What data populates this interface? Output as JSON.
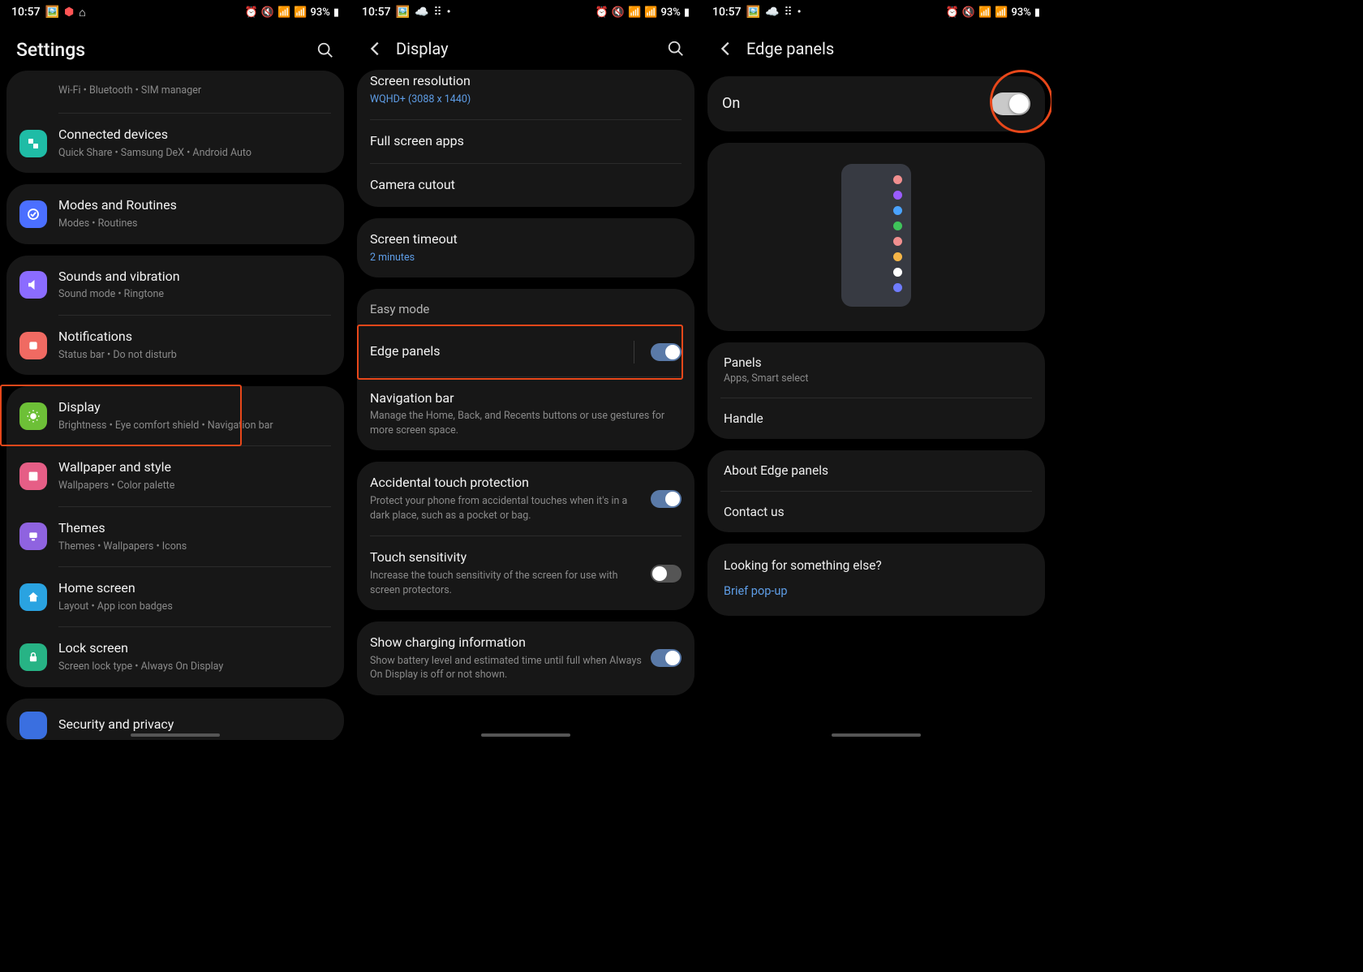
{
  "status": {
    "time": "10:57",
    "battery_text": "93%"
  },
  "panel1": {
    "title": "Settings",
    "items": [
      {
        "id": "connections-sub",
        "sub": "Wi-Fi  •  Bluetooth  •  SIM manager"
      },
      {
        "id": "connected",
        "title": "Connected devices",
        "sub": "Quick Share  •  Samsung DeX  •  Android Auto"
      },
      {
        "id": "modes",
        "title": "Modes and Routines",
        "sub": "Modes  •  Routines"
      },
      {
        "id": "sounds",
        "title": "Sounds and vibration",
        "sub": "Sound mode  •  Ringtone"
      },
      {
        "id": "notif",
        "title": "Notifications",
        "sub": "Status bar  •  Do not disturb"
      },
      {
        "id": "display",
        "title": "Display",
        "sub": "Brightness  •  Eye comfort shield  •  Navigation bar"
      },
      {
        "id": "wallpaper",
        "title": "Wallpaper and style",
        "sub": "Wallpapers  •  Color palette"
      },
      {
        "id": "themes",
        "title": "Themes",
        "sub": "Themes  •  Wallpapers  •  Icons"
      },
      {
        "id": "home",
        "title": "Home screen",
        "sub": "Layout  •  App icon badges"
      },
      {
        "id": "lock",
        "title": "Lock screen",
        "sub": "Screen lock type  •  Always On Display"
      },
      {
        "id": "security",
        "title": "Security and privacy"
      }
    ]
  },
  "panel2": {
    "title": "Display",
    "screen_res_title": "Screen resolution",
    "screen_res_sub": "WQHD+ (3088 x 1440)",
    "full_screen": "Full screen apps",
    "camera_cutout": "Camera cutout",
    "screen_timeout_title": "Screen timeout",
    "screen_timeout_sub": "2 minutes",
    "easy_mode": "Easy mode",
    "edge_panels": "Edge panels",
    "nav_bar_title": "Navigation bar",
    "nav_bar_sub": "Manage the Home, Back, and Recents buttons or use gestures for more screen space.",
    "atp_title": "Accidental touch protection",
    "atp_sub": "Protect your phone from accidental touches when it's in a dark place, such as a pocket or bag.",
    "touch_sens_title": "Touch sensitivity",
    "touch_sens_sub": "Increase the touch sensitivity of the screen for use with screen protectors.",
    "charging_title": "Show charging information",
    "charging_sub": "Show battery level and estimated time until full when Always On Display is off or not shown."
  },
  "panel3": {
    "title": "Edge panels",
    "on_label": "On",
    "panels_title": "Panels",
    "panels_sub": "Apps, Smart select",
    "handle": "Handle",
    "about": "About Edge panels",
    "contact": "Contact us",
    "looking_title": "Looking for something else?",
    "looking_link": "Brief pop-up",
    "preview_dots": [
      "#f18f8f",
      "#9a5cff",
      "#4aa3ff",
      "#3fc35a",
      "#f18f8f",
      "#f5b547",
      "#ffffff",
      "#6f7cff"
    ]
  }
}
